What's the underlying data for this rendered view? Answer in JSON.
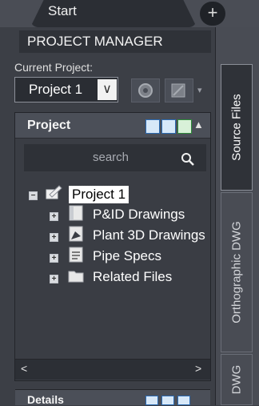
{
  "tabs": {
    "start_label": "Start",
    "new_tab_symbol": "+"
  },
  "palette": {
    "title": "PROJECT MANAGER"
  },
  "current_project": {
    "label": "Current Project:",
    "value": "Project 1",
    "dropdown_symbol": "∨"
  },
  "project_panel": {
    "title": "Project",
    "collapse_symbol": "▲",
    "search_placeholder": "search",
    "tree": {
      "root": {
        "label": "Project 1",
        "toggle": "−"
      },
      "children": [
        {
          "label": "P&ID Drawings",
          "toggle": "+",
          "icon": "pid-drawings-icon"
        },
        {
          "label": "Plant 3D Drawings",
          "toggle": "+",
          "icon": "plant3d-drawings-icon"
        },
        {
          "label": "Pipe Specs",
          "toggle": "+",
          "icon": "pipe-specs-icon"
        },
        {
          "label": "Related Files",
          "toggle": "+",
          "icon": "folder-icon"
        }
      ]
    },
    "scroll_left": "<",
    "scroll_right": ">"
  },
  "details_panel": {
    "title": "Details"
  },
  "side_tabs": [
    {
      "label": "Source Files",
      "active": true
    },
    {
      "label": "Orthographic DWG",
      "active": false
    },
    {
      "label": "DWG",
      "active": false
    }
  ],
  "colors": {
    "background": "#3a3d44",
    "selection_bg": "#ffffff",
    "accent": "#2c6bb3"
  }
}
